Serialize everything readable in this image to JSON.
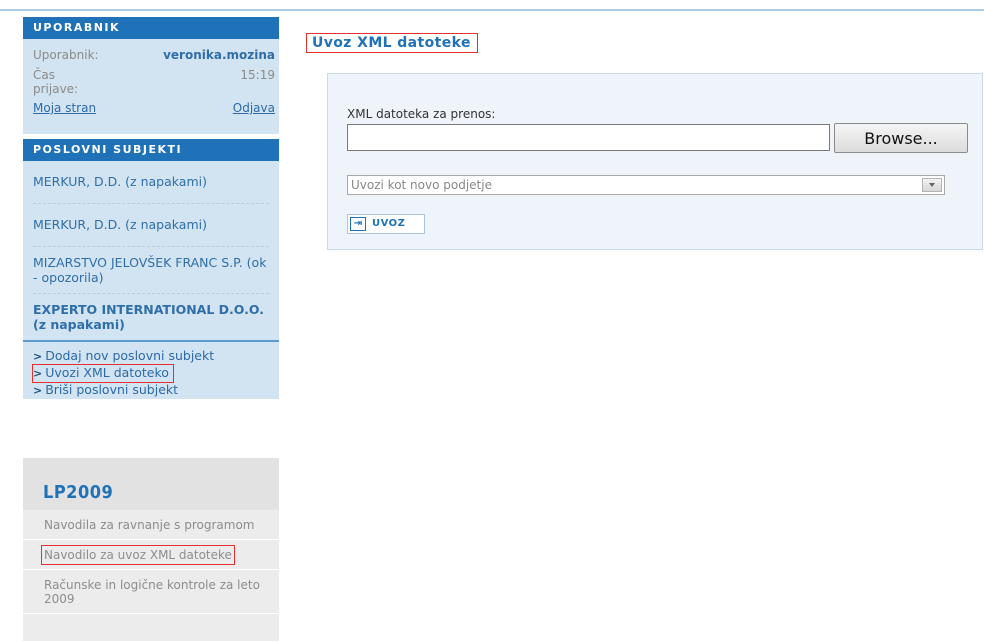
{
  "user_box": {
    "heading": "UPORABNIK",
    "user_label": "Uporabnik:",
    "user_value": "veronika.mozina",
    "login_label_1": "Čas",
    "login_label_2": "prijave:",
    "login_value": "15:19",
    "my_page": "Moja stran",
    "logout": "Odjava"
  },
  "subjects_box": {
    "heading": "POSLOVNI SUBJEKTI",
    "items": [
      "MERKUR, D.D. (z napakami)",
      "MERKUR, D.D. (z napakami)",
      "MIZARSTVO JELOVŠEK FRANC S.P. (ok - opozorila)",
      "EXPERTO INTERNATIONAL D.O.O. (z napakami)"
    ],
    "actions": [
      "Dodaj nov poslovni subjekt",
      "Uvozi XML datoteko",
      "Briši poslovni subjekt"
    ]
  },
  "lp_box": {
    "title": "LP2009",
    "items": [
      "Navodila za ravnanje s programom",
      "Navodilo za uvoz XML datoteke",
      "Računske in logične kontrole za leto 2009"
    ]
  },
  "main": {
    "title": "Uvoz XML datoteke",
    "file_label": "XML datoteka za prenos:",
    "file_value": "",
    "browse_label": "Browse...",
    "select_value": "Uvozi kot novo podjetje",
    "import_label": "UVOZ"
  },
  "colors": {
    "accent": "#1f72b8",
    "sidebar_bg": "#d2e4f1",
    "highlight_border": "#e53030"
  }
}
